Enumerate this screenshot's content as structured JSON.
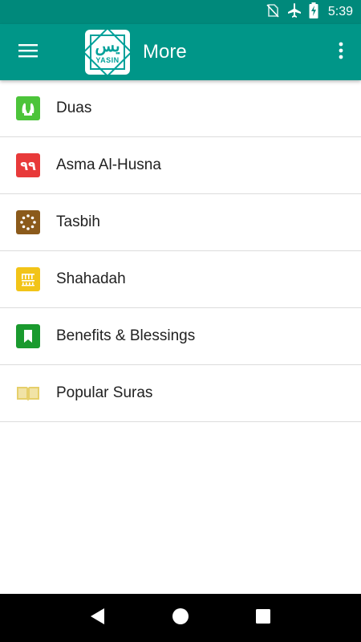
{
  "status_bar": {
    "time": "5:39",
    "icons": [
      "no-sim-icon",
      "airplane-mode-icon",
      "battery-charging-icon"
    ]
  },
  "app_bar": {
    "title": "More",
    "logo": {
      "arabic": "يس",
      "text": "YASIN"
    },
    "icons": [
      "menu-icon",
      "overflow-menu-icon"
    ]
  },
  "menu": {
    "items": [
      {
        "label": "Duas",
        "icon": "praying-hands-icon",
        "color": "#4cc43a"
      },
      {
        "label": "Asma Al-Husna",
        "icon": "asma-99-icon",
        "badge": "٩٩",
        "color": "#e83a3a"
      },
      {
        "label": "Tasbih",
        "icon": "tasbih-beads-icon",
        "color": "#8b5a1b"
      },
      {
        "label": "Shahadah",
        "icon": "shahadah-calligraphy-icon",
        "color": "#f2c418"
      },
      {
        "label": "Benefits & Blessings",
        "icon": "bookmark-icon",
        "color": "#1a9a2e"
      },
      {
        "label": "Popular Suras",
        "icon": "open-book-icon",
        "color": "#e6cf6a"
      }
    ]
  },
  "colors": {
    "primary": "#009688",
    "status_bar": "#00897b",
    "divider": "#dcdcdc"
  },
  "nav_bar": {
    "icons": [
      "back-icon",
      "home-icon",
      "recents-icon"
    ]
  }
}
